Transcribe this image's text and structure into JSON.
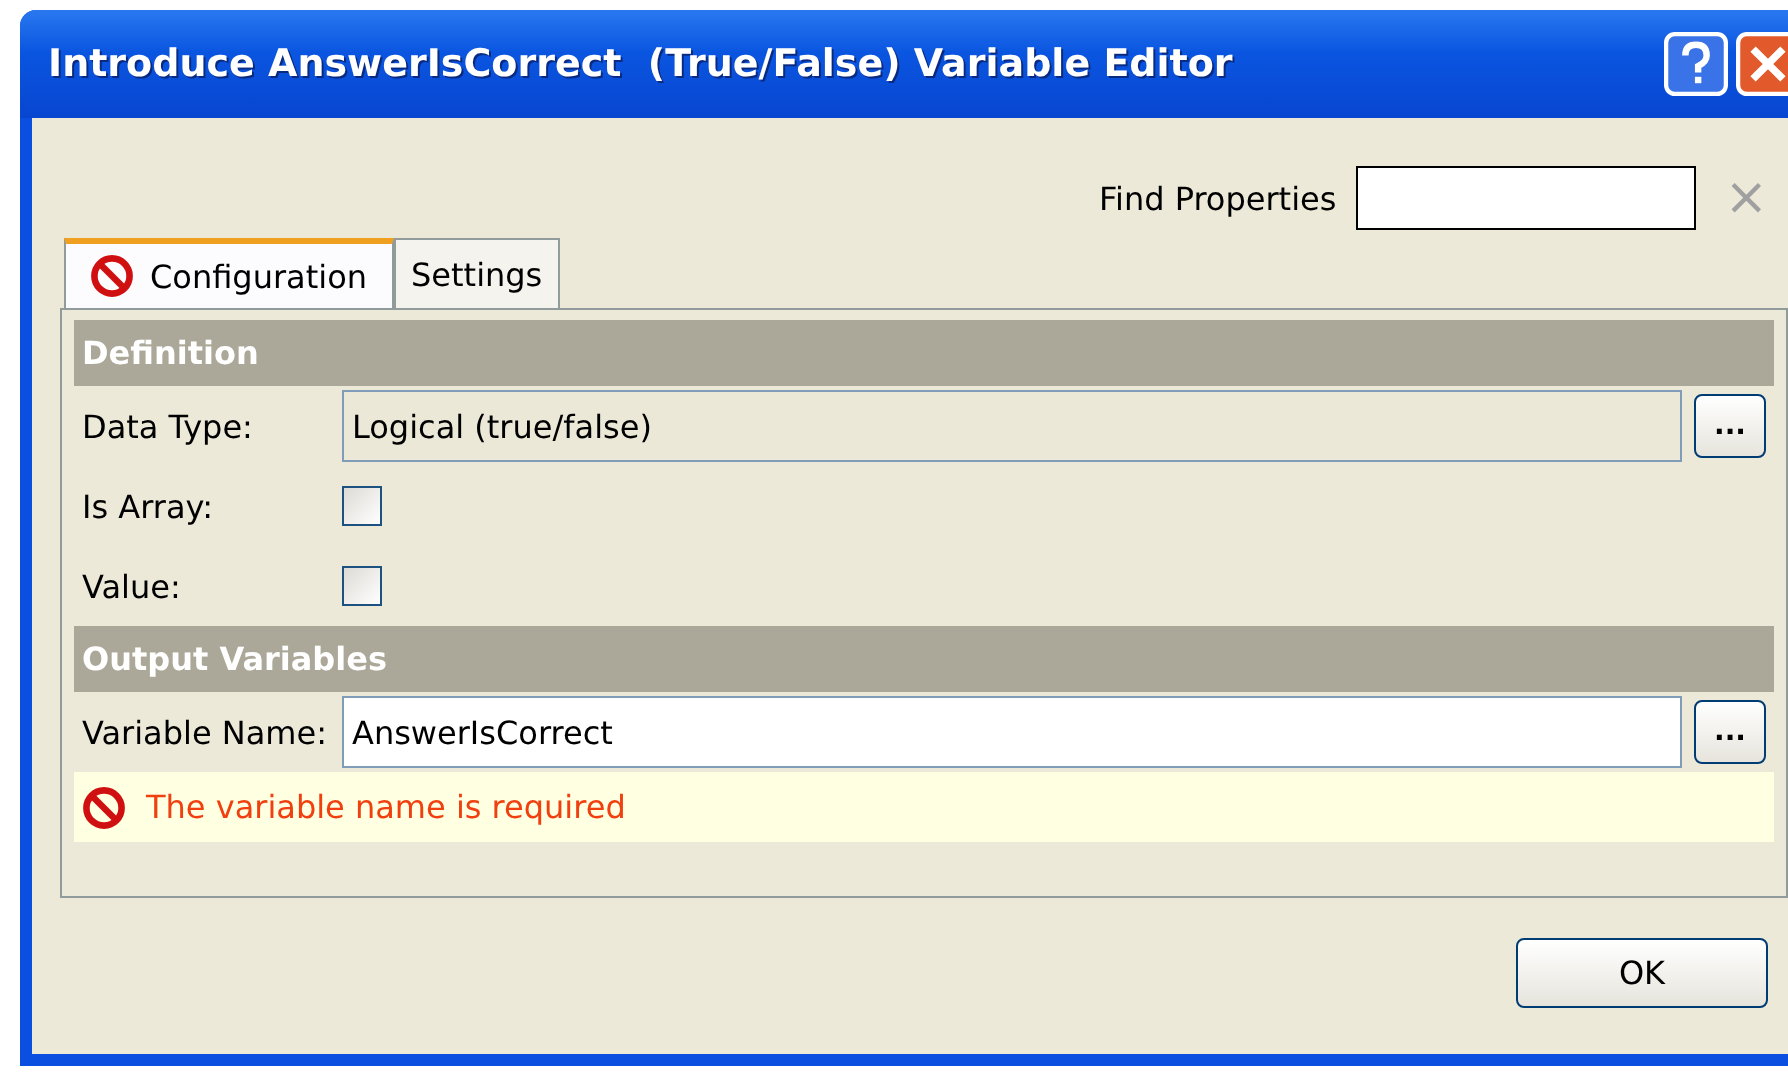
{
  "window": {
    "title": "Introduce AnswerIsCorrect  (True/False) Variable Editor"
  },
  "find": {
    "label": "Find Properties",
    "clear": "×"
  },
  "tabs": [
    {
      "label": "Configuration",
      "selected": true,
      "has_error": true
    },
    {
      "label": "Settings",
      "selected": false,
      "has_error": false
    }
  ],
  "sections": [
    {
      "title": "Definition",
      "rows": [
        {
          "kind": "text",
          "label": "Data Type:",
          "value": "Logical (true/false)",
          "readonly": true,
          "browse": "..."
        },
        {
          "kind": "checkbox",
          "label": "Is Array:",
          "checked": false
        },
        {
          "kind": "checkbox",
          "label": "Value:",
          "checked": false
        }
      ]
    },
    {
      "title": "Output Variables",
      "rows": [
        {
          "kind": "text",
          "label": "Variable Name:",
          "value": "AnswerIsCorrect",
          "readonly": false,
          "browse": "..."
        },
        {
          "kind": "error",
          "message": "The variable name is required"
        }
      ]
    }
  ],
  "buttons": [
    "OK"
  ]
}
